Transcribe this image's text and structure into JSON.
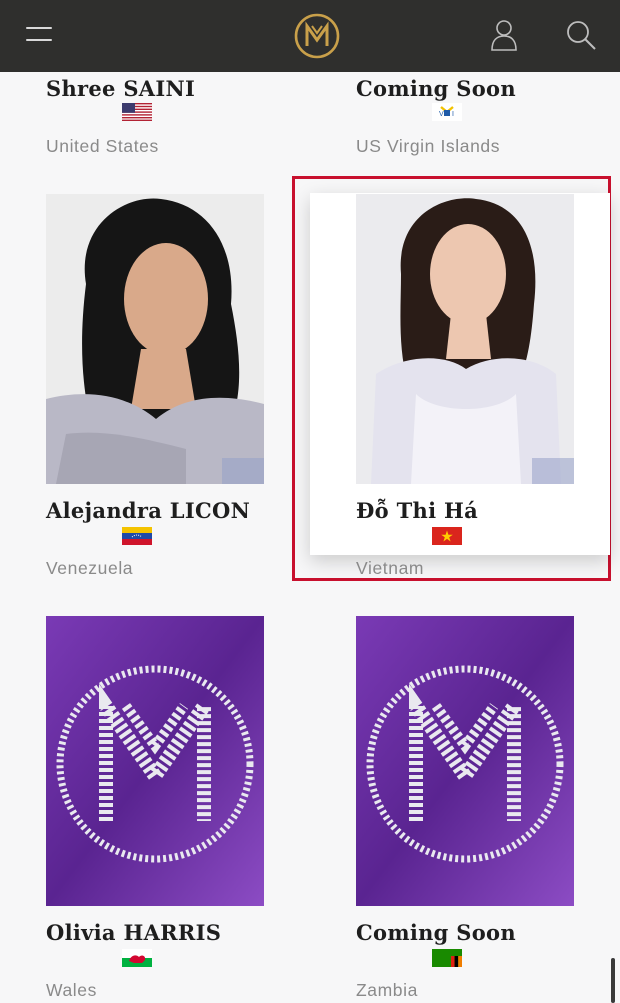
{
  "header": {
    "menu_icon": "hamburger-menu-icon",
    "logo_icon": "miss-world-logo-icon",
    "user_icon": "user-account-icon",
    "search_icon": "search-icon"
  },
  "contestants": [
    {
      "name": "Shree SAINI",
      "country": "United States",
      "flag": "us-flag"
    },
    {
      "name": "Coming Soon",
      "country": "US Virgin Islands",
      "flag": "us-virgin-islands-flag"
    },
    {
      "name": "Alejandra LICON",
      "country": "Venezuela",
      "flag": "venezuela-flag"
    },
    {
      "name": "Đỗ Thi Há",
      "country": "Vietnam",
      "flag": "vietnam-flag"
    },
    {
      "name": "Olivia HARRIS",
      "country": "Wales",
      "flag": "wales-flag"
    },
    {
      "name": "Coming Soon",
      "country": "Zambia",
      "flag": "zambia-flag"
    }
  ],
  "colors": {
    "header_bg": "#2f2f2d",
    "gold": "#c9a04a",
    "highlight": "#c8102e",
    "placeholder_purple": "#6b2fa3"
  }
}
